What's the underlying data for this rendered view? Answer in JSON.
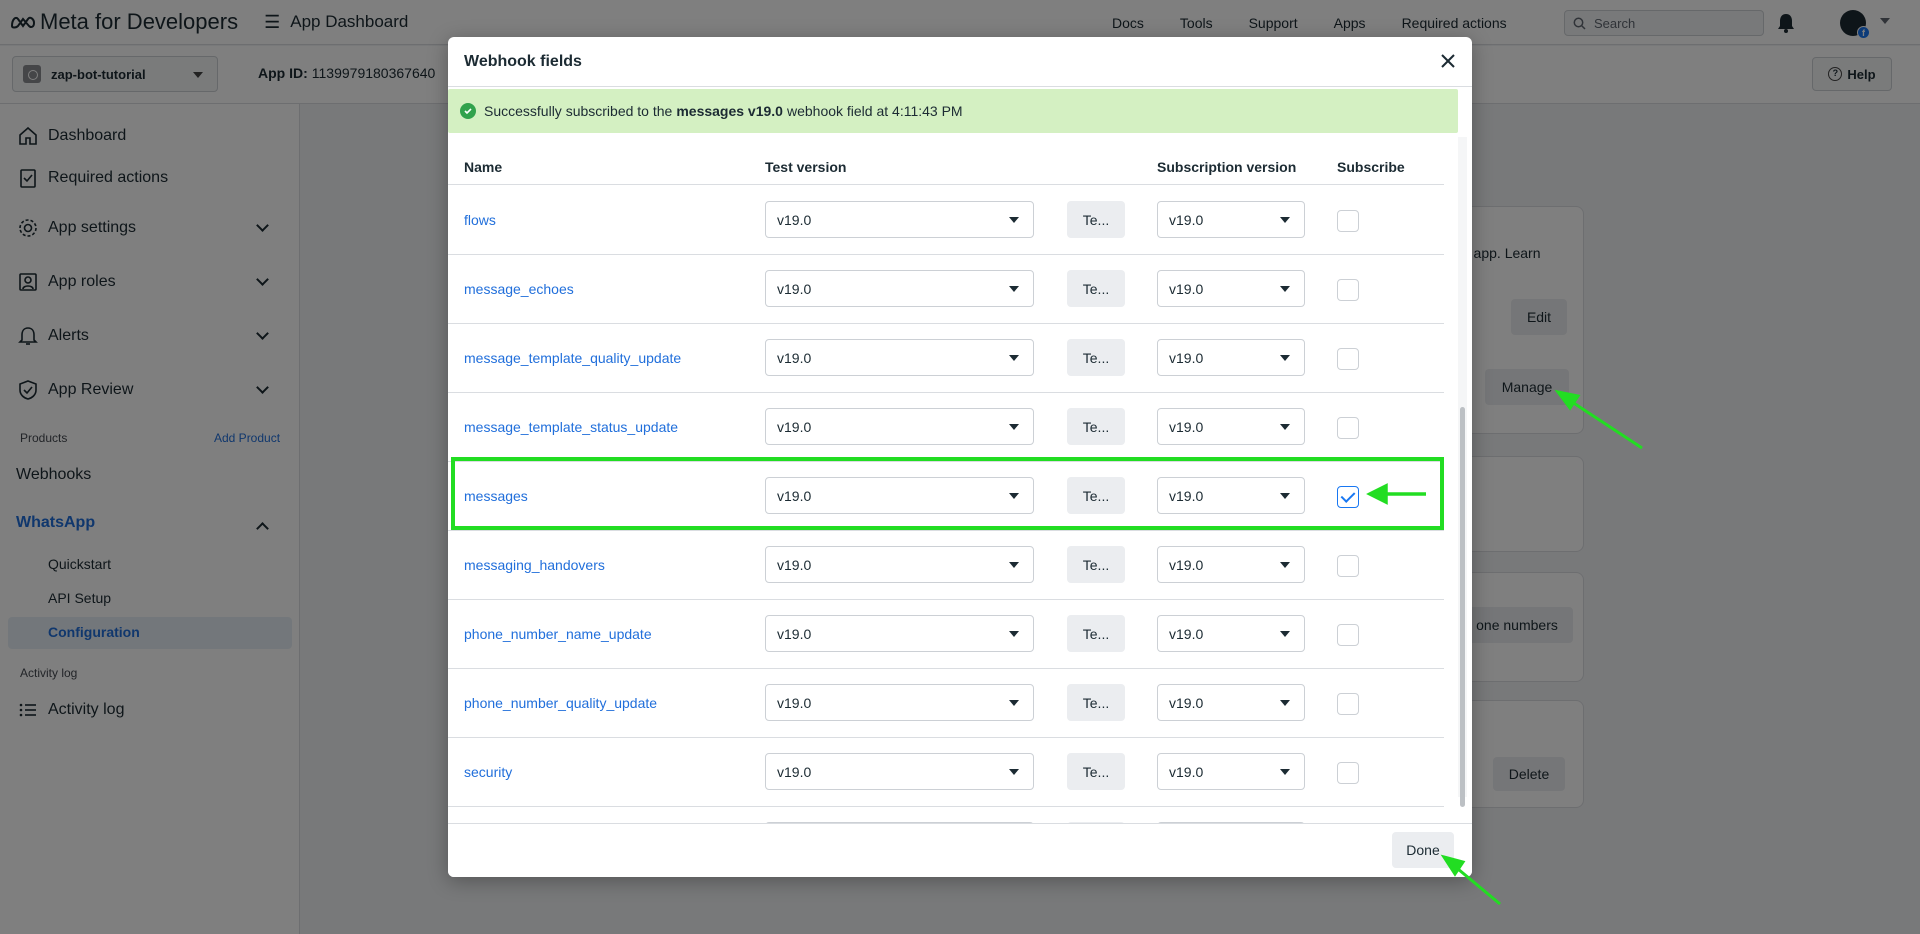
{
  "topbar": {
    "brand": "Meta for Developers",
    "app_dashboard": "App Dashboard",
    "nav": [
      "Docs",
      "Tools",
      "Support",
      "Apps",
      "Required actions"
    ],
    "search_placeholder": "Search"
  },
  "subbar": {
    "app_name": "zap-bot-tutorial",
    "app_id_label": "App ID:",
    "app_id_value": "1139979180367640",
    "help_label": "Help"
  },
  "sidebar": {
    "items": [
      {
        "label": "Dashboard",
        "icon": "home-icon"
      },
      {
        "label": "Required actions",
        "icon": "clipboard-check-icon"
      },
      {
        "label": "App settings",
        "icon": "gear-icon"
      },
      {
        "label": "App roles",
        "icon": "person-badge-icon"
      },
      {
        "label": "Alerts",
        "icon": "bell-icon"
      },
      {
        "label": "App Review",
        "icon": "shield-check-icon"
      }
    ],
    "products_label": "Products",
    "add_product_label": "Add Product",
    "webhooks_label": "Webhooks",
    "whatsapp_label": "WhatsApp",
    "whatsapp_sub": [
      "Quickstart",
      "API Setup",
      "Configuration"
    ],
    "activity_section_label": "Activity log",
    "activity_item_label": "Activity log"
  },
  "background": {
    "learn_text": "r app. Learn",
    "edit_label": "Edit",
    "manage_label": "Manage",
    "phone_numbers_label": "one numbers",
    "delete_label": "Delete"
  },
  "modal": {
    "title": "Webhook fields",
    "alert_prefix": "Successfully subscribed to the",
    "alert_field": "messages v19.0",
    "alert_suffix": "webhook field at 4:11:43 PM",
    "columns": {
      "name": "Name",
      "test_version": "Test version",
      "subscription_version": "Subscription version",
      "subscribe": "Subscribe"
    },
    "test_button_label": "Te...",
    "rows": [
      {
        "name": "flows",
        "test_version": "v19.0",
        "sub_version": "v19.0",
        "subscribed": false
      },
      {
        "name": "message_echoes",
        "test_version": "v19.0",
        "sub_version": "v19.0",
        "subscribed": false
      },
      {
        "name": "message_template_quality_update",
        "test_version": "v19.0",
        "sub_version": "v19.0",
        "subscribed": false
      },
      {
        "name": "message_template_status_update",
        "test_version": "v19.0",
        "sub_version": "v19.0",
        "subscribed": false
      },
      {
        "name": "messages",
        "test_version": "v19.0",
        "sub_version": "v19.0",
        "subscribed": true
      },
      {
        "name": "messaging_handovers",
        "test_version": "v19.0",
        "sub_version": "v19.0",
        "subscribed": false
      },
      {
        "name": "phone_number_name_update",
        "test_version": "v19.0",
        "sub_version": "v19.0",
        "subscribed": false
      },
      {
        "name": "phone_number_quality_update",
        "test_version": "v19.0",
        "sub_version": "v19.0",
        "subscribed": false
      },
      {
        "name": "security",
        "test_version": "v19.0",
        "sub_version": "v19.0",
        "subscribed": false
      }
    ],
    "done_label": "Done"
  },
  "colors": {
    "link": "#216fdb",
    "highlight": "#22dd22",
    "success_bg": "#d4f0c2",
    "checkbox_blue": "#1877f2"
  }
}
